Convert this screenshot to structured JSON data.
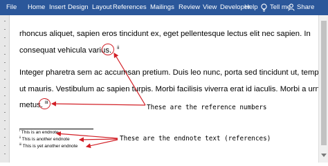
{
  "ribbon": {
    "tabs": [
      "File",
      "Home",
      "Insert",
      "Design",
      "Layout",
      "References",
      "Mailings",
      "Review",
      "View",
      "Developer",
      "Help"
    ],
    "active_tab": "File",
    "tell_me": "Tell me",
    "share": "Share",
    "bar_color": "#2b579a"
  },
  "document": {
    "para1_line1": "rhoncus aliquet, sapien eros tincidunt ex, eget pellentesque lectus elit nec sapien. In",
    "para1_line2": "consequat vehicula varius.",
    "ref_ii": "ii",
    "para2_line1": "Integer pharetra sem ac accumsan pretium. Duis leo nunc, porta sed tincidunt ut, tempus",
    "para2_line2": "ut mauris. Vestibulum ac sapien turpis. Morbi facilisis viverra erat id iaculis. Morbi a urna",
    "para2_line3": "metus.",
    "ref_iii": "iii"
  },
  "endnotes": [
    {
      "mark": "i",
      "text": "This is an endnote"
    },
    {
      "mark": "ii",
      "text": "This is another endnote"
    },
    {
      "mark": "iii",
      "text": "This is yet another endnote"
    }
  ],
  "annotations": {
    "reference_numbers": "These are the reference numbers",
    "endnote_text": "These are the endnote text (references)",
    "highlight_color": "#d21f26"
  }
}
